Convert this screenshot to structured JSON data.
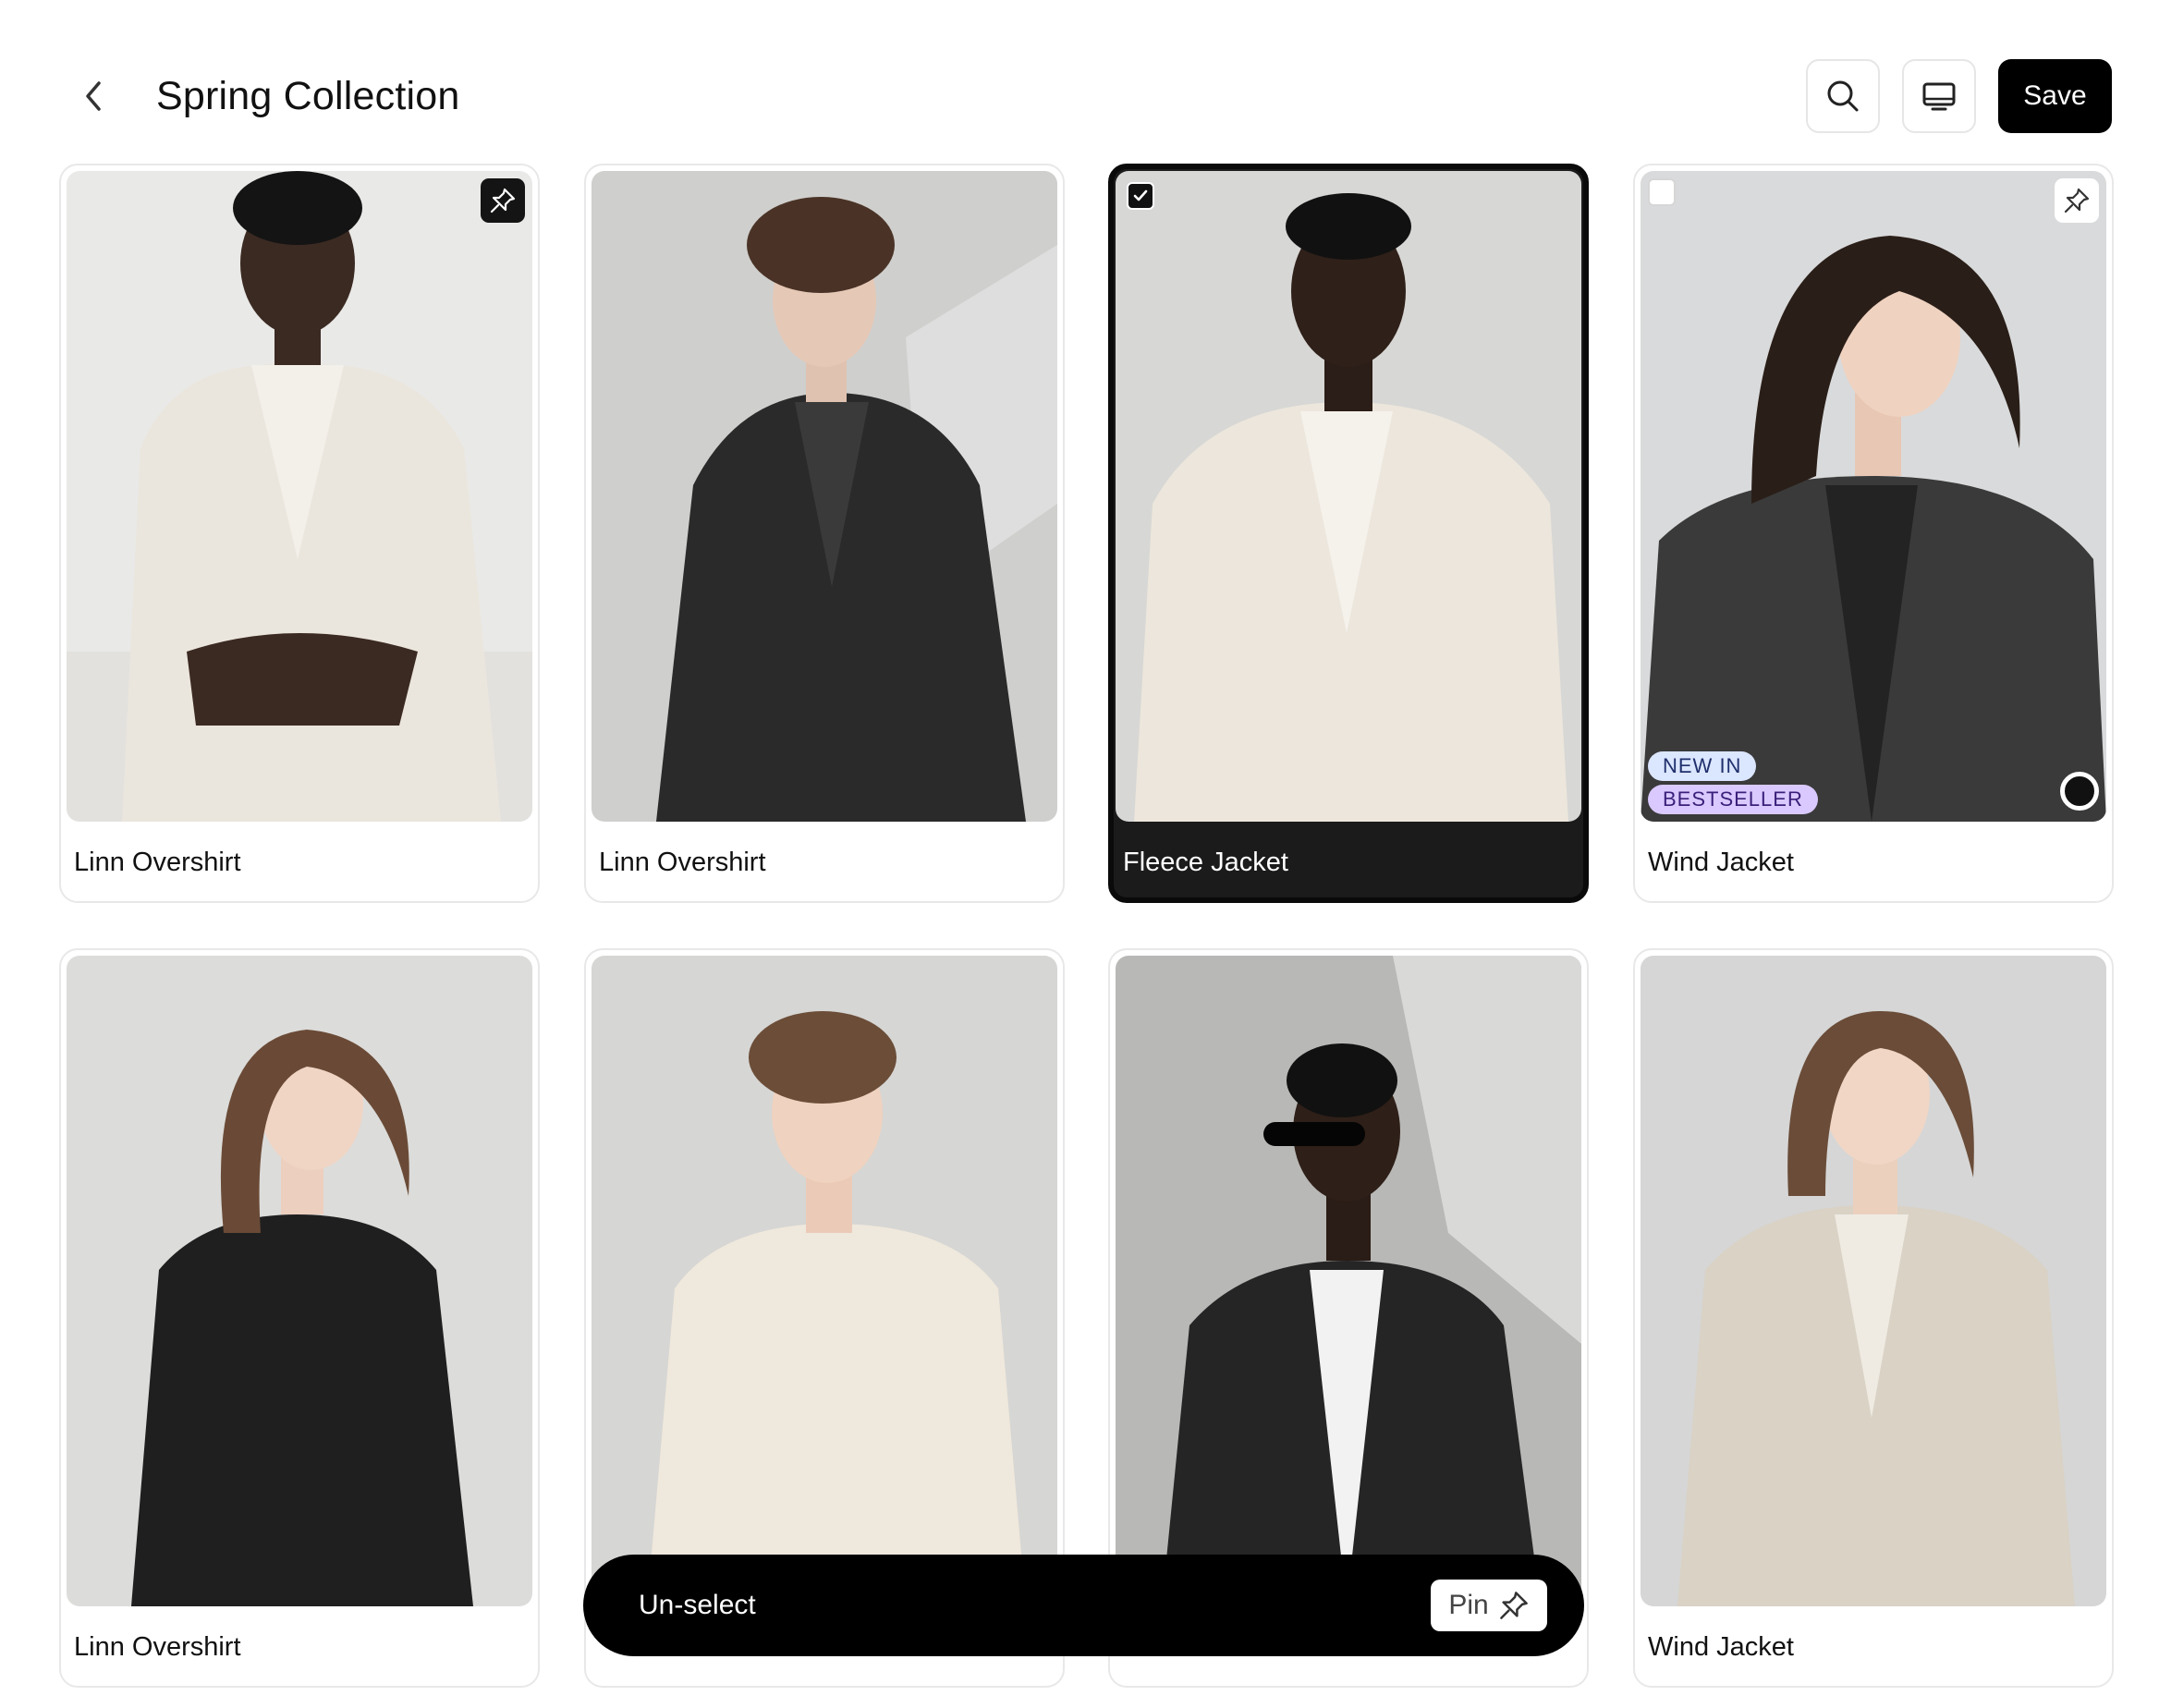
{
  "header": {
    "title": "Spring Collection",
    "save_label": "Save",
    "icons": [
      "chevron-left-icon",
      "search-icon",
      "monitor-icon"
    ]
  },
  "products": [
    {
      "name": "Linn Overshirt",
      "pinned": true,
      "selected": false,
      "outfit_color": "#ebe6dd"
    },
    {
      "name": "Linn Overshirt",
      "pinned": false,
      "selected": false,
      "outfit_color": "#2a2a2a"
    },
    {
      "name": "Fleece Jacket",
      "pinned": false,
      "selected": true,
      "outfit_color": "#ece6dc"
    },
    {
      "name": "Wind Jacket",
      "pinned": false,
      "selected": false,
      "badges": [
        "NEW IN",
        "BESTSELLER"
      ],
      "outfit_color": "#3a3a3a"
    },
    {
      "name": "Linn Overshirt",
      "pinned": false,
      "selected": false,
      "outfit_color": "#1f1f1f"
    },
    {
      "name": "",
      "pinned": false,
      "selected": false,
      "outfit_color": "#efe8dc"
    },
    {
      "name": "",
      "pinned": false,
      "selected": false,
      "outfit_color": "#252525"
    },
    {
      "name": "Wind Jacket",
      "pinned": false,
      "selected": false,
      "outfit_color": "#d9d2c5"
    }
  ],
  "action_bar": {
    "unselect_label": "Un-select",
    "pin_label": "Pin"
  },
  "colors": {
    "accent": "#000000",
    "tag_new_bg": "#dbe6ff",
    "tag_best_bg": "#d9c9ff"
  }
}
